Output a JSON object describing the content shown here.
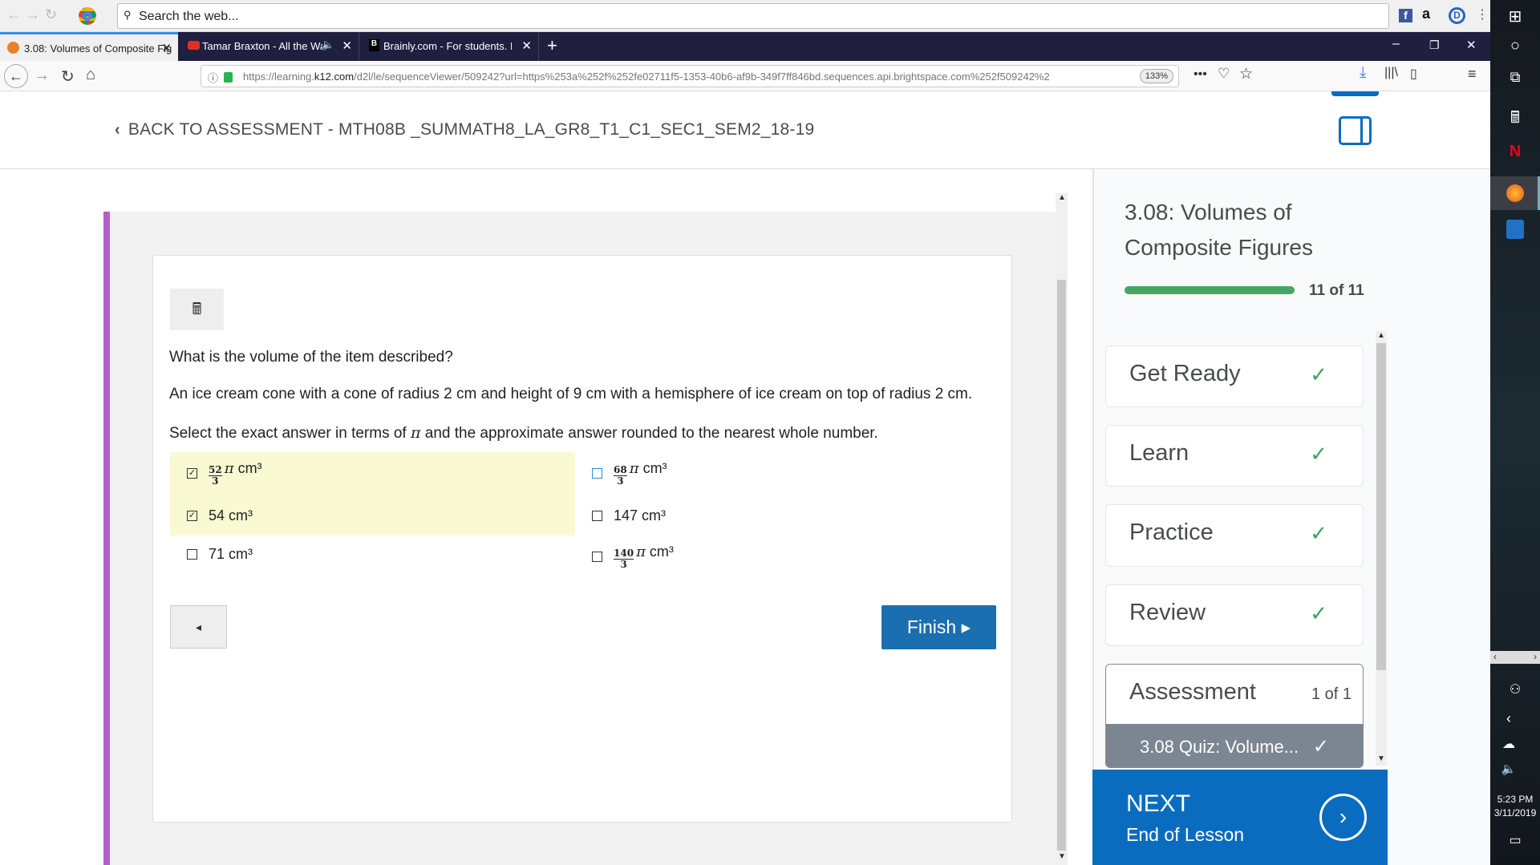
{
  "browser": {
    "search_placeholder": "Search the web...",
    "tabs": [
      {
        "label": "3.08: Volumes of Composite Fig"
      },
      {
        "label": "Tamar Braxton - All the Way"
      },
      {
        "label": "Brainly.com - For students. By s"
      }
    ],
    "url_prefix": "https://learning.",
    "url_domain": "k12.com",
    "url_rest": "/d2l/le/sequenceViewer/509242?url=https%253a%252f%252fe02711f5-1353-40b6-af9b-349f7ff846bd.sequences.api.brightspace.com%252f509242%2",
    "zoom": "133%"
  },
  "header": {
    "back_label": "BACK TO ASSESSMENT - MTH08B _SUMMATH8_LA_GR8_T1_C1_SEC1_SEM2_18-19"
  },
  "question": {
    "prompt": "What is the volume of the item described?",
    "description": "An ice cream cone with a cone of radius 2 cm and height of 9 cm with a hemisphere of ice cream on top of radius 2 cm.",
    "instruction_before": "Select the exact answer in terms of",
    "instruction_pi": "π",
    "instruction_after": "and the approximate answer rounded to the nearest whole number.",
    "options": [
      {
        "num": "52",
        "den": "3",
        "pi": "π",
        "unit": "cm³",
        "checked": true
      },
      {
        "num": "68",
        "den": "3",
        "pi": "π",
        "unit": "cm³",
        "checked": false
      },
      {
        "text": "54 cm³",
        "checked": true
      },
      {
        "text": "147 cm³",
        "checked": false
      },
      {
        "text": "71 cm³",
        "checked": false
      },
      {
        "num": "140",
        "den": "3",
        "pi": "π",
        "unit": "cm³",
        "checked": false
      }
    ],
    "highlight_color": "#fafad2",
    "finish_label": "Finish ▸",
    "prev_label": "◂"
  },
  "panel": {
    "title_line1": "3.08: Volumes of",
    "title_line2": "Composite Figures",
    "progress_text": "11 of 11",
    "progress_percent": 100,
    "progress_color": "#46a661",
    "items": [
      {
        "label": "Get Ready",
        "check": "✓"
      },
      {
        "label": "Learn",
        "check": "✓"
      },
      {
        "label": "Practice",
        "check": "✓"
      },
      {
        "label": "Review",
        "check": "✓"
      }
    ],
    "assessment": {
      "label": "Assessment",
      "count": "1 of 1",
      "sub_label": "3.08 Quiz: Volume...",
      "sub_check": "✓"
    },
    "next": {
      "title": "NEXT",
      "subtitle": "End of Lesson",
      "color": "#0a6cbf"
    }
  },
  "taskbar": {
    "time": "5:23 PM",
    "date": "3/11/2019"
  }
}
